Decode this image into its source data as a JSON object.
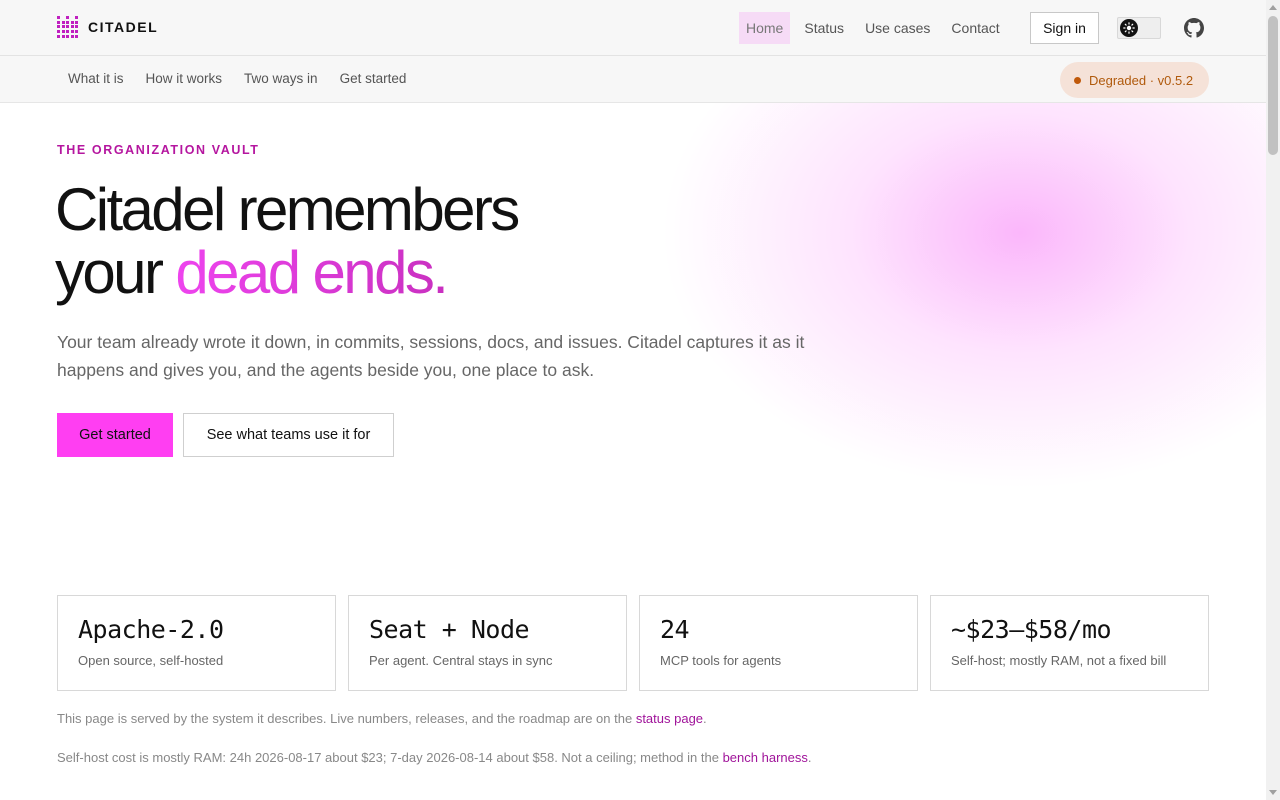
{
  "brand": {
    "name": "CITADEL",
    "icon": "citadel-logo-icon",
    "accent": "#c020c0"
  },
  "nav": {
    "items": [
      {
        "label": "Home",
        "active": true
      },
      {
        "label": "Status",
        "active": false
      },
      {
        "label": "Use cases",
        "active": false
      },
      {
        "label": "Contact",
        "active": false
      }
    ],
    "signin_label": "Sign in",
    "theme_toggle_icon": "sun-icon",
    "github_icon": "github-icon"
  },
  "subnav": {
    "items": [
      {
        "label": "What it is"
      },
      {
        "label": "How it works"
      },
      {
        "label": "Two ways in"
      },
      {
        "label": "Get started"
      }
    ],
    "status": {
      "text": "Degraded · v0.5.2",
      "color": "#b05a0c"
    }
  },
  "hero": {
    "eyebrow": "THE ORGANIZATION VAULT",
    "headline_line1": "Citadel remembers",
    "headline_line2_plain": "your ",
    "headline_line2_accent": "dead ends.",
    "lede": "Your team already wrote it down, in commits, sessions, docs, and issues. Citadel captures it as it happens and gives you, and the agents beside you, one place to ask.",
    "primary_cta": "Get started",
    "secondary_cta": "See what teams use it for",
    "accent_color": "#ff3ef2"
  },
  "stats": [
    {
      "value": "Apache-2.0",
      "label": "Open source, self-hosted"
    },
    {
      "value": "Seat + Node",
      "label": "Per agent. Central stays in sync"
    },
    {
      "value": "24",
      "label": "MCP tools for agents"
    },
    {
      "value": "~$23–$58/mo",
      "label": "Self-host; mostly RAM, not a fixed bill"
    }
  ],
  "notes": {
    "note1_text": "This page is served by the system it describes. Live numbers, releases, and the roadmap are on the ",
    "note1_link": "status page",
    "note1_end": ".",
    "note2_text": "Self-host cost is mostly RAM: 24h 2026-08-17 about $23; 7-day 2026-08-14 about $58. Not a ceiling; method in the ",
    "note2_link": "bench harness",
    "note2_end": "."
  }
}
